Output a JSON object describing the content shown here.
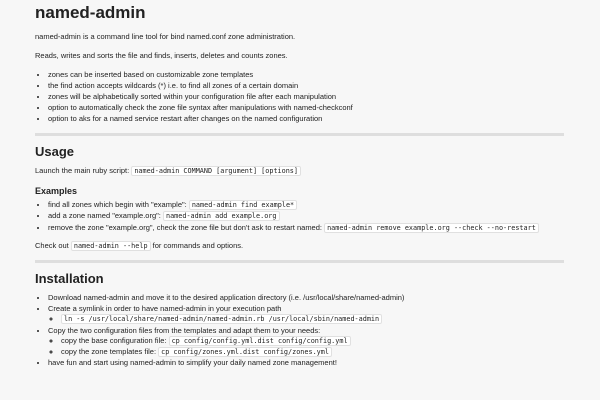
{
  "title": "named-admin",
  "intro1": "named-admin is a command line tool for bind named.conf zone administration.",
  "intro2": "Reads, writes and sorts the file and finds, inserts, deletes and counts zones.",
  "features": [
    "zones can be inserted based on customizable zone templates",
    "the find action accepts wildcards (*) i.e. to find all zones of a certain domain",
    "zones will be alphabetically sorted within your configuration file after each manipulation",
    "option to automatically check the zone file syntax after manipulations with named-checkconf",
    "option to aks for a named service restart after changes on the named configuration"
  ],
  "usage": {
    "heading": "Usage",
    "launch_text": "Launch the main ruby script:",
    "launch_code": "named-admin COMMAND [argument] [options]",
    "examples_heading": "Examples",
    "examples": [
      {
        "text": "find all zones which begin with \"example\":",
        "code": "named-admin find example*"
      },
      {
        "text": "add a zone named \"example.org\":",
        "code": "named-admin add example.org"
      },
      {
        "text": "remove the zone \"example.org\", check the zone file but don't ask to restart named:",
        "code": "named-admin remove example.org --check --no-restart"
      }
    ],
    "help_pre": "Check out",
    "help_code": "named-admin --help",
    "help_post": "for commands and options."
  },
  "installation": {
    "heading": "Installation",
    "step1": "Download named-admin and move it to the desired application directory (i.e. /usr/local/share/named-admin)",
    "step2": "Create a symlink in order to have named-admin in your execution path",
    "step2_code": "ln -s /usr/local/share/named-admin/named-admin.rb /usr/local/sbin/named-admin",
    "step3": "Copy the two configuration files from the templates and adapt them to your needs:",
    "step3_sub": [
      {
        "text": "copy the base configuration file:",
        "code": "cp config/config.yml.dist config/config.yml"
      },
      {
        "text": "copy the zone templates file:",
        "code": "cp config/zones.yml.dist config/zones.yml"
      }
    ],
    "step4": "have fun and start using named-admin to simplify your daily named zone management!"
  }
}
